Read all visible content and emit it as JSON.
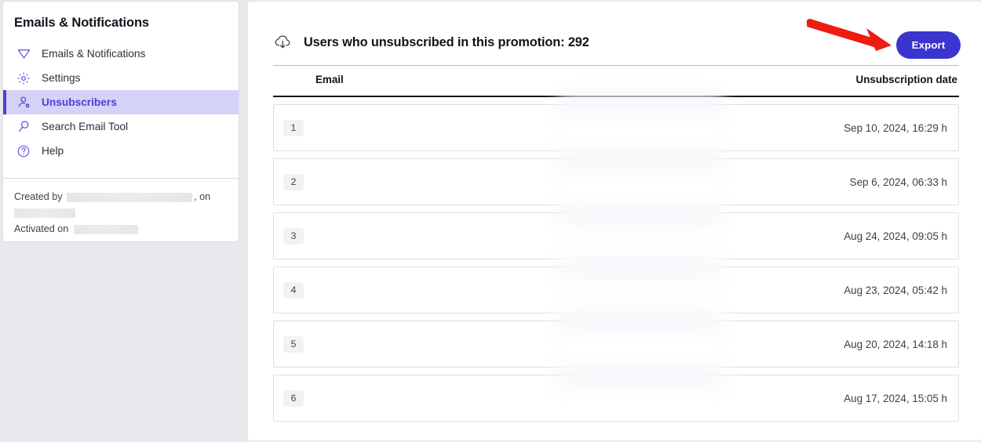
{
  "sidebar": {
    "title": "Emails & Notifications",
    "items": [
      {
        "label": "Emails & Notifications",
        "icon": "paper-plane-icon",
        "active": false
      },
      {
        "label": "Settings",
        "icon": "gear-icon",
        "active": false
      },
      {
        "label": "Unsubscribers",
        "icon": "user-unsubscribe-icon",
        "active": true
      },
      {
        "label": "Search Email Tool",
        "icon": "magnifier-icon",
        "active": false
      },
      {
        "label": "Help",
        "icon": "question-circle-icon",
        "active": false
      }
    ],
    "footer": {
      "created_by_label": "Created by",
      "created_by_value": "",
      "created_on_separator": ", on",
      "created_on_value": "",
      "activated_on_label": "Activated on",
      "activated_on_value": ""
    }
  },
  "main": {
    "header_icon": "cloud-download-icon",
    "title": "Users who unsubscribed in this promotion: 292",
    "unsubscriber_count": "292",
    "export_label": "Export",
    "columns": {
      "email": "Email",
      "date": "Unsubscription date"
    },
    "rows": [
      {
        "index": "1",
        "email": "",
        "date": "Sep 10, 2024, 16:29 h"
      },
      {
        "index": "2",
        "email": "",
        "date": "Sep 6, 2024, 06:33 h"
      },
      {
        "index": "3",
        "email": "",
        "date": "Aug 24, 2024, 09:05 h"
      },
      {
        "index": "4",
        "email": "",
        "date": "Aug 23, 2024, 05:42 h"
      },
      {
        "index": "5",
        "email": "",
        "date": "Aug 20, 2024, 14:18 h"
      },
      {
        "index": "6",
        "email": "",
        "date": "Aug 17, 2024, 15:05 h"
      }
    ]
  },
  "annotation": {
    "arrow": "red-arrow-pointing-to-export",
    "color": "#ee1c11"
  },
  "colors": {
    "accent": "#4a40d6",
    "button": "#3b35cf",
    "active_nav_bg": "#d5d2f7",
    "page_bg": "#e9e9ed"
  }
}
